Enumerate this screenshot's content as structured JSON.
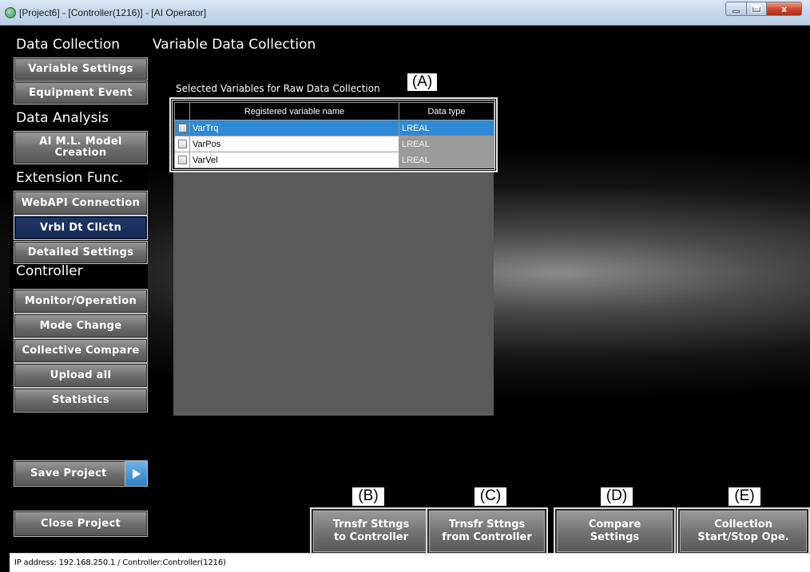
{
  "window": {
    "title": "[Project6] - [Controller(1216)] - [AI Operator]",
    "controls": {
      "minimize": "minimize",
      "maximize": "maximize",
      "close": "x"
    }
  },
  "sidebar": {
    "sections": {
      "data_collection": "Data Collection",
      "data_analysis": "Data Analysis",
      "extension": "Extension Func.",
      "controller": "Controller"
    },
    "items": [
      {
        "label": "Variable Settings"
      },
      {
        "label": "Equipment Event"
      },
      {
        "label": "AI M.L. Model\nCreation"
      },
      {
        "label": "WebAPI Connection"
      },
      {
        "label": "Vrbl Dt Cllctn",
        "active": true
      },
      {
        "label": "Detailed Settings"
      },
      {
        "label": "Monitor/Operation"
      },
      {
        "label": "Mode Change"
      },
      {
        "label": "Collective Compare"
      },
      {
        "label": "Upload all"
      },
      {
        "label": "Statistics"
      }
    ],
    "save_project": "Save Project",
    "close_project": "Close Project"
  },
  "main": {
    "page_title": "Variable Data Collection",
    "table_caption": "Selected Variables for Raw Data Collection",
    "table": {
      "columns": [
        "Registered variable name",
        "Data type"
      ],
      "rows": [
        {
          "name": "VarTrq",
          "type": "LREAL",
          "checked": false,
          "selected": true
        },
        {
          "name": "VarPos",
          "type": "LREAL",
          "checked": false,
          "selected": false
        },
        {
          "name": "VarVel",
          "type": "LREAL",
          "checked": false,
          "selected": false
        }
      ]
    },
    "callouts": {
      "a": "(A)",
      "b": "(B)",
      "c": "(C)",
      "d": "(D)",
      "e": "(E)"
    },
    "actions": {
      "transfer_to": "Trnsfr Sttngs\nto Controller",
      "transfer_from": "Trnsfr Sttngs\nfrom Controller",
      "compare": "Compare\nSettings",
      "collection": "Collection\nStart/Stop Ope."
    }
  },
  "status": {
    "text": "IP address: 192.168.250.1 / Controller:Controller(1216)"
  },
  "colors": {
    "selected_row": "#2f8ad6",
    "active_nav": "#1f3769",
    "save_arrow": "#2f7fc4",
    "close_button": "#c9452c"
  },
  "icons": {
    "app": "app-icon",
    "save_arrow": "play-arrow-icon"
  }
}
